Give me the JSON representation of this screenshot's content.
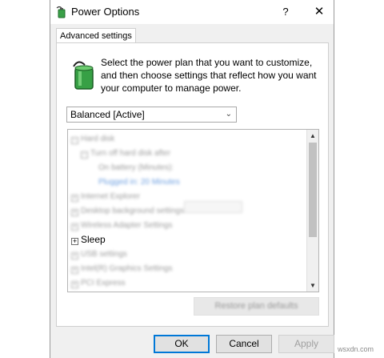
{
  "window": {
    "title": "Power Options",
    "help_label": "?",
    "close_label": "✕"
  },
  "tab": {
    "label": "Advanced settings"
  },
  "description": "Select the power plan that you want to customize, and then choose settings that reflect how you want your computer to manage power.",
  "plan_select": {
    "value": "Balanced [Active]"
  },
  "tree": {
    "items": [
      {
        "label": "Hard disk",
        "level": 0,
        "expander": "−"
      },
      {
        "label": "Turn off hard disk after",
        "level": 1,
        "expander": "−"
      },
      {
        "label": "On battery (Minutes):",
        "level": 2
      },
      {
        "label": "Plugged in: 20 Minutes",
        "level": 2
      },
      {
        "label": "Internet Explorer",
        "level": 0,
        "expander": "+"
      },
      {
        "label": "Desktop background settings",
        "level": 0,
        "expander": "+"
      },
      {
        "label": "Wireless Adapter Settings",
        "level": 0,
        "expander": "+"
      },
      {
        "label": "Sleep",
        "level": 0,
        "expander": "+"
      },
      {
        "label": "USB settings",
        "level": 0,
        "expander": "+"
      },
      {
        "label": "Intel(R) Graphics Settings",
        "level": 0,
        "expander": "+"
      },
      {
        "label": "PCI Express",
        "level": 0,
        "expander": "+"
      }
    ]
  },
  "buttons": {
    "restore": "Restore plan defaults",
    "ok": "OK",
    "cancel": "Cancel",
    "apply": "Apply"
  },
  "watermark": "wsxdn.com"
}
